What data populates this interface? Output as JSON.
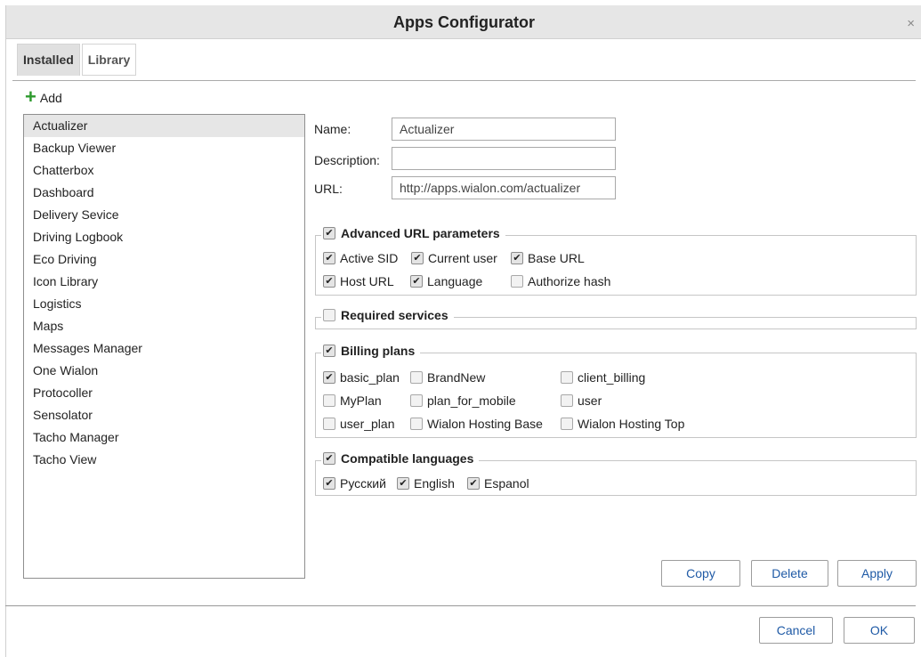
{
  "window": {
    "title": "Apps Configurator",
    "close_glyph": "×"
  },
  "tabs": [
    {
      "label": "Installed",
      "active": true
    },
    {
      "label": "Library",
      "active": false
    }
  ],
  "add_label": "Add",
  "apps": [
    "Actualizer",
    "Backup Viewer",
    "Chatterbox",
    "Dashboard",
    "Delivery Sevice",
    "Driving Logbook",
    "Eco Driving",
    "Icon Library",
    "Logistics",
    "Maps",
    "Messages Manager",
    "One Wialon",
    "Protocoller",
    "Sensolator",
    "Tacho Manager",
    "Tacho View"
  ],
  "selected_app": "Actualizer",
  "form": {
    "name_label": "Name:",
    "name_value": "Actualizer",
    "description_label": "Description:",
    "description_value": "",
    "url_label": "URL:",
    "url_value": "http://apps.wialon.com/actualizer"
  },
  "advanced": {
    "legend": "Advanced URL parameters",
    "checked": true,
    "options": [
      {
        "label": "Active SID",
        "checked": true
      },
      {
        "label": "Current user",
        "checked": true
      },
      {
        "label": "Base URL",
        "checked": true
      },
      {
        "label": "Host URL",
        "checked": true
      },
      {
        "label": "Language",
        "checked": true
      },
      {
        "label": "Authorize hash",
        "checked": false
      }
    ]
  },
  "services": {
    "legend": "Required services",
    "checked": false
  },
  "billing": {
    "legend": "Billing plans",
    "checked": true,
    "options": [
      {
        "label": "basic_plan",
        "checked": true
      },
      {
        "label": "BrandNew",
        "checked": false
      },
      {
        "label": "client_billing",
        "checked": false
      },
      {
        "label": "MyPlan",
        "checked": false
      },
      {
        "label": "plan_for_mobile",
        "checked": false
      },
      {
        "label": "user",
        "checked": false
      },
      {
        "label": "user_plan",
        "checked": false
      },
      {
        "label": "Wialon Hosting Base",
        "checked": false
      },
      {
        "label": "Wialon Hosting Top",
        "checked": false
      }
    ]
  },
  "languages": {
    "legend": "Compatible languages",
    "checked": true,
    "options": [
      {
        "label": "Русский",
        "checked": true
      },
      {
        "label": "English",
        "checked": true
      },
      {
        "label": "Espanol",
        "checked": true
      }
    ]
  },
  "buttons": {
    "copy": "Copy",
    "delete": "Delete",
    "apply": "Apply",
    "cancel": "Cancel",
    "ok": "OK"
  },
  "check_glyph": "✔"
}
